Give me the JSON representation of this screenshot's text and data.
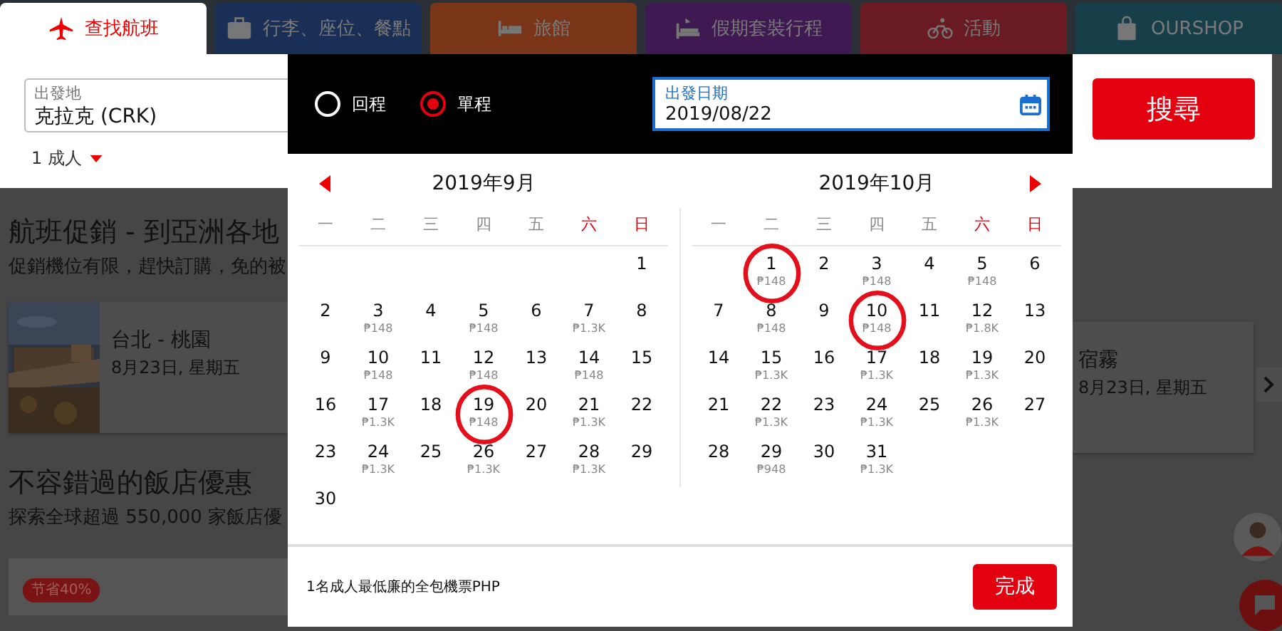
{
  "tabs": [
    {
      "label": "查找航班",
      "selected": true,
      "color": "#ffffff"
    },
    {
      "label": "行李、座位、餐點",
      "selected": false,
      "color": "#1a2f55"
    },
    {
      "label": "旅館",
      "selected": false,
      "color": "#7a3417"
    },
    {
      "label": "假期套裝行程",
      "selected": false,
      "color": "#3f1a52"
    },
    {
      "label": "活動",
      "selected": false,
      "color": "#6a1a22"
    },
    {
      "label": "OURSHOP",
      "selected": false,
      "color": "#173f4a"
    }
  ],
  "search": {
    "origin_label": "出發地",
    "origin_value": "克拉克 (CRK)",
    "passengers": "1 成人",
    "button": "搜尋"
  },
  "flight_promo": {
    "title": "航班促銷 - 到亞洲各地",
    "subtitle": "促銷機位有限，趕快訂購，免的被",
    "cards": [
      {
        "title": "台北 - 桃園",
        "date": "8月23日, 星期五",
        "kind": "picture"
      },
      {
        "title": "宿霧",
        "date": "8月23日, 星期五"
      }
    ]
  },
  "hotel_promo": {
    "title": "不容錯過的飯店優惠",
    "subtitle": "探索全球超過 550,000 家飯店優",
    "badge": "节省40%"
  },
  "date_picker": {
    "trip_types": [
      {
        "label": "回程",
        "selected": false
      },
      {
        "label": "單程",
        "selected": true
      }
    ],
    "date_field": {
      "label": "出發日期",
      "value": "2019/08/22"
    },
    "months": [
      {
        "title": "2019年9月",
        "weekdays": [
          {
            "label": "一",
            "weekend": false
          },
          {
            "label": "二",
            "weekend": false
          },
          {
            "label": "三",
            "weekend": false
          },
          {
            "label": "四",
            "weekend": false
          },
          {
            "label": "五",
            "weekend": false
          },
          {
            "label": "六",
            "weekend": true
          },
          {
            "label": "日",
            "weekend": true
          }
        ],
        "weeks": [
          [
            {
              "day": "1",
              "circled": false
            }
          ],
          [
            {
              "day": "2",
              "circled": false
            },
            {
              "day": "3",
              "price": "₱148",
              "circled": false
            },
            {
              "day": "4",
              "circled": false
            },
            {
              "day": "5",
              "price": "₱148",
              "circled": false
            },
            {
              "day": "6",
              "circled": false
            },
            {
              "day": "7",
              "price": "₱1.3K",
              "circled": false
            },
            {
              "day": "8",
              "circled": false
            }
          ],
          [
            {
              "day": "9",
              "circled": false
            },
            {
              "day": "10",
              "price": "₱148",
              "circled": false
            },
            {
              "day": "11",
              "circled": false
            },
            {
              "day": "12",
              "price": "₱148",
              "circled": false
            },
            {
              "day": "13",
              "circled": false
            },
            {
              "day": "14",
              "price": "₱148",
              "circled": false
            },
            {
              "day": "15",
              "circled": false
            }
          ],
          [
            {
              "day": "16",
              "circled": false
            },
            {
              "day": "17",
              "price": "₱1.3K",
              "circled": false
            },
            {
              "day": "18",
              "circled": false
            },
            {
              "day": "19",
              "price": "₱148",
              "circled": true
            },
            {
              "day": "20",
              "circled": false
            },
            {
              "day": "21",
              "price": "₱1.3K",
              "circled": false
            },
            {
              "day": "22",
              "circled": false
            }
          ],
          [
            {
              "day": "23",
              "circled": false
            },
            {
              "day": "24",
              "price": "₱1.3K",
              "circled": false
            },
            {
              "day": "25",
              "circled": false
            },
            {
              "day": "26",
              "price": "₱1.3K",
              "circled": false
            },
            {
              "day": "27",
              "circled": false
            },
            {
              "day": "28",
              "price": "₱1.3K",
              "circled": false
            },
            {
              "day": "29",
              "circled": false
            }
          ],
          [
            {
              "day": "30",
              "circled": false
            }
          ]
        ]
      },
      {
        "title": "2019年10月",
        "weekdays": [
          {
            "label": "一",
            "weekend": false
          },
          {
            "label": "二",
            "weekend": false
          },
          {
            "label": "三",
            "weekend": false
          },
          {
            "label": "四",
            "weekend": false
          },
          {
            "label": "五",
            "weekend": false
          },
          {
            "label": "六",
            "weekend": true
          },
          {
            "label": "日",
            "weekend": true
          }
        ],
        "weeks": [
          [
            {
              "day": "1",
              "price": "₱148",
              "circled": true
            },
            {
              "day": "2",
              "circled": false
            },
            {
              "day": "3",
              "price": "₱148",
              "circled": false
            },
            {
              "day": "4",
              "circled": false
            },
            {
              "day": "5",
              "price": "₱148",
              "circled": false
            },
            {
              "day": "6",
              "circled": false
            }
          ],
          [
            {
              "day": "7",
              "circled": false
            },
            {
              "day": "8",
              "price": "₱148",
              "circled": false
            },
            {
              "day": "9",
              "circled": false
            },
            {
              "day": "10",
              "price": "₱148",
              "circled": true
            },
            {
              "day": "11",
              "circled": false
            },
            {
              "day": "12",
              "price": "₱1.8K",
              "circled": false
            },
            {
              "day": "13",
              "circled": false
            }
          ],
          [
            {
              "day": "14",
              "circled": false
            },
            {
              "day": "15",
              "price": "₱1.3K",
              "circled": false
            },
            {
              "day": "16",
              "circled": false
            },
            {
              "day": "17",
              "price": "₱1.3K",
              "circled": false
            },
            {
              "day": "18",
              "circled": false
            },
            {
              "day": "19",
              "price": "₱1.3K",
              "circled": false
            },
            {
              "day": "20",
              "circled": false
            }
          ],
          [
            {
              "day": "21",
              "circled": false
            },
            {
              "day": "22",
              "price": "₱1.3K",
              "circled": false
            },
            {
              "day": "23",
              "circled": false
            },
            {
              "day": "24",
              "price": "₱1.3K",
              "circled": false
            },
            {
              "day": "25",
              "circled": false
            },
            {
              "day": "26",
              "price": "₱1.3K",
              "circled": false
            },
            {
              "day": "27",
              "circled": false
            }
          ],
          [
            {
              "day": "28",
              "circled": false
            },
            {
              "day": "29",
              "price": "₱948",
              "circled": false
            },
            {
              "day": "30",
              "circled": false
            },
            {
              "day": "31",
              "price": "₱1.3K",
              "circled": false
            }
          ]
        ]
      }
    ],
    "footer_note": "1名成人最低廉的全包機票PHP",
    "done_button": "完成"
  }
}
